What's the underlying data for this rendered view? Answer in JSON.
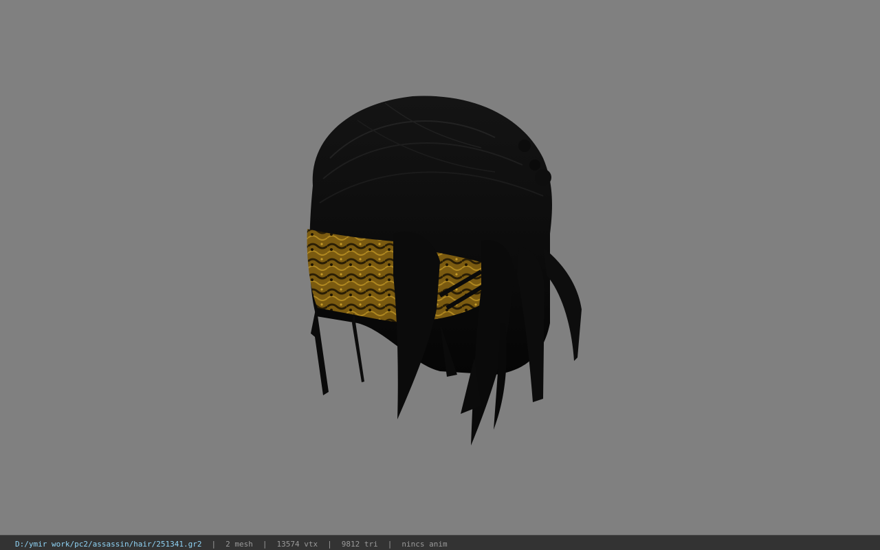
{
  "viewer": {
    "background_color": "#808080",
    "model_name": "hair-model"
  },
  "status_bar": {
    "file_path": "D:/ymir work/pc2/assassin/hair/251341.gr2",
    "mesh_count": "2 mesh",
    "vertex_count": "13574 vtx",
    "triangle_count": "9812 tri",
    "animation_status": "nincs anim",
    "separator": "|",
    "path_color": "#8fd3f5",
    "text_color": "#9a9a9a",
    "bar_color": "#333333"
  }
}
